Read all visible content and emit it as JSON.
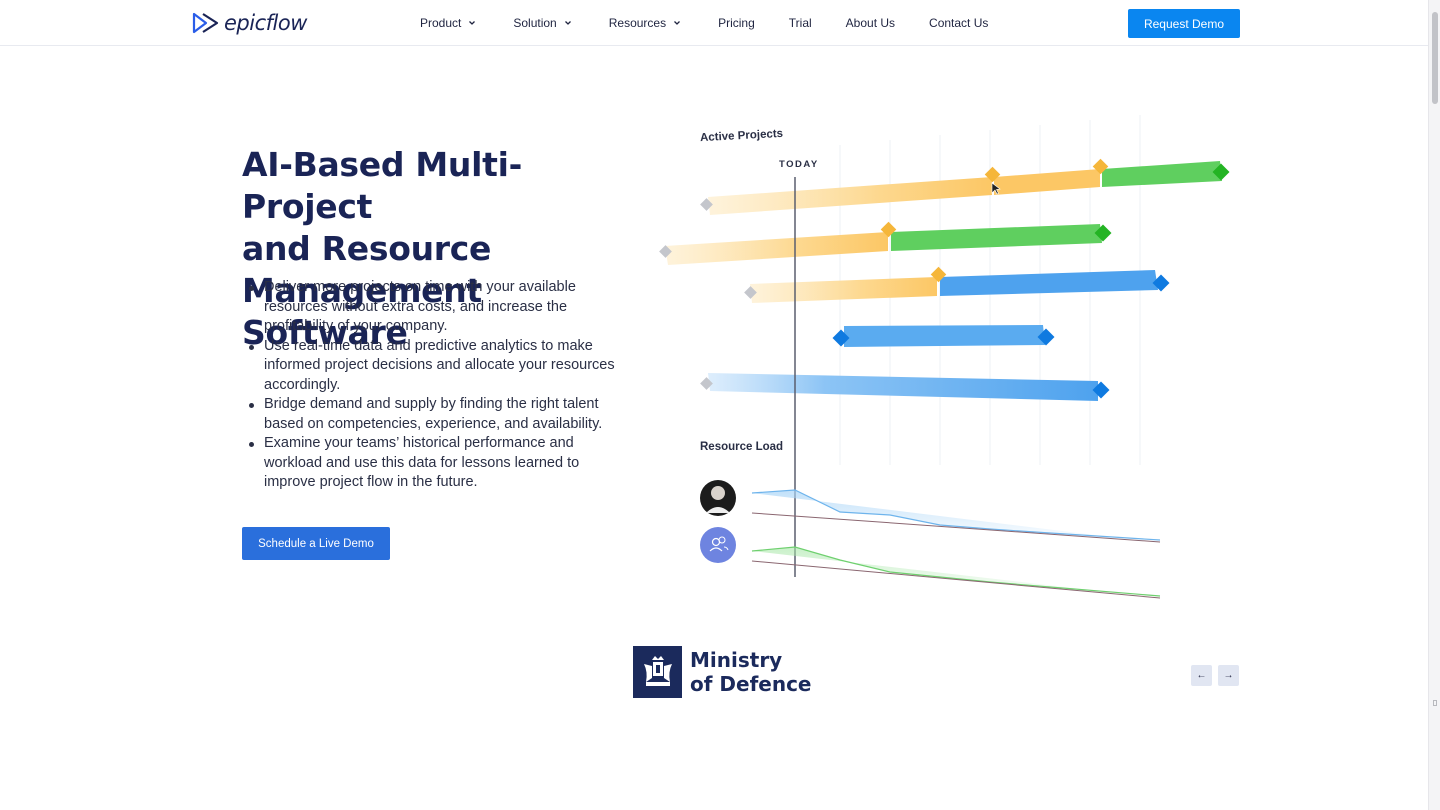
{
  "header": {
    "logo_text": "epicflow",
    "nav": [
      {
        "label": "Product",
        "has_dropdown": true
      },
      {
        "label": "Solution",
        "has_dropdown": true
      },
      {
        "label": "Resources",
        "has_dropdown": true
      },
      {
        "label": "Pricing",
        "has_dropdown": false
      },
      {
        "label": "Trial",
        "has_dropdown": false
      },
      {
        "label": "About Us",
        "has_dropdown": false
      },
      {
        "label": "Contact Us",
        "has_dropdown": false
      }
    ],
    "cta_label": "Request Demo"
  },
  "hero": {
    "title_lines": [
      "AI-Based Multi-Project",
      "and Resource",
      "Management Software"
    ],
    "bullets": [
      "Deliver more projects on time with your available resources without extra costs, and increase the profitability of your company.",
      "Use real-time data and predictive analytics to make informed project decisions and allocate your resources accordingly.",
      "Bridge demand and supply by finding the right talent based on competencies, experience, and availability.",
      "Examine your teams’ historical performance and workload and use this data for lessons learned to improve project flow in the future."
    ],
    "cta_label": "Schedule a Live Demo"
  },
  "illustration": {
    "active_projects_label": "Active Projects",
    "today_label": "TODAY",
    "resource_load_label": "Resource Load"
  },
  "clients": {
    "current": {
      "name_lines": [
        "Ministry",
        "of Defence"
      ]
    },
    "prev_label": "←",
    "next_label": "→"
  },
  "colors": {
    "brand_navy": "#1a2456",
    "cta_blue": "#0a86f0",
    "bar_orange": "#fcc765",
    "bar_green": "#5fcf5f",
    "bar_blue": "#5aabf0"
  }
}
